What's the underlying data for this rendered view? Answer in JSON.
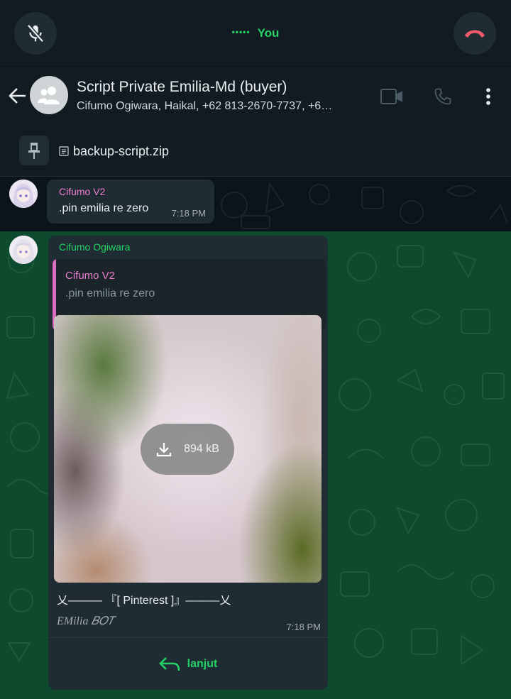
{
  "call": {
    "status_text": "You",
    "indicator": "•••••"
  },
  "header": {
    "title": "Script Private Emilia-Md (buyer)",
    "subtitle": "Cifumo Ogiwara, Haikal, +62 813-2670-7737, +6…"
  },
  "pinned": {
    "file_name": "backup-script.zip"
  },
  "messages": [
    {
      "sender": "Cifumo V2",
      "text": ".pin emilia re zero",
      "time": "7:18 PM"
    },
    {
      "sender": "Cifumo Ogiwara",
      "quote": {
        "sender": "Cifumo V2",
        "text": ".pin emilia re zero"
      },
      "image": {
        "download_size": "894 kB"
      },
      "caption_line1": "乂——— 『[ Pinterest ]』———乂",
      "caption_line2": "EMilia  𝐵𝑂𝑇",
      "time": "7:18 PM",
      "reply_button": "lanjut"
    }
  ],
  "colors": {
    "accent_green": "#25d366",
    "end_call_red": "#f15c6d",
    "sender_pink": "#ee7bd1",
    "bubble_bg": "#202c33",
    "chat_bg_green": "#0e4a2e"
  },
  "icons": [
    "mic-off-icon",
    "end-call-icon",
    "back-arrow-icon",
    "group-icon",
    "video-call-icon",
    "phone-icon",
    "more-vert-icon",
    "pin-icon",
    "document-icon",
    "download-icon",
    "reply-arrow-icon"
  ]
}
